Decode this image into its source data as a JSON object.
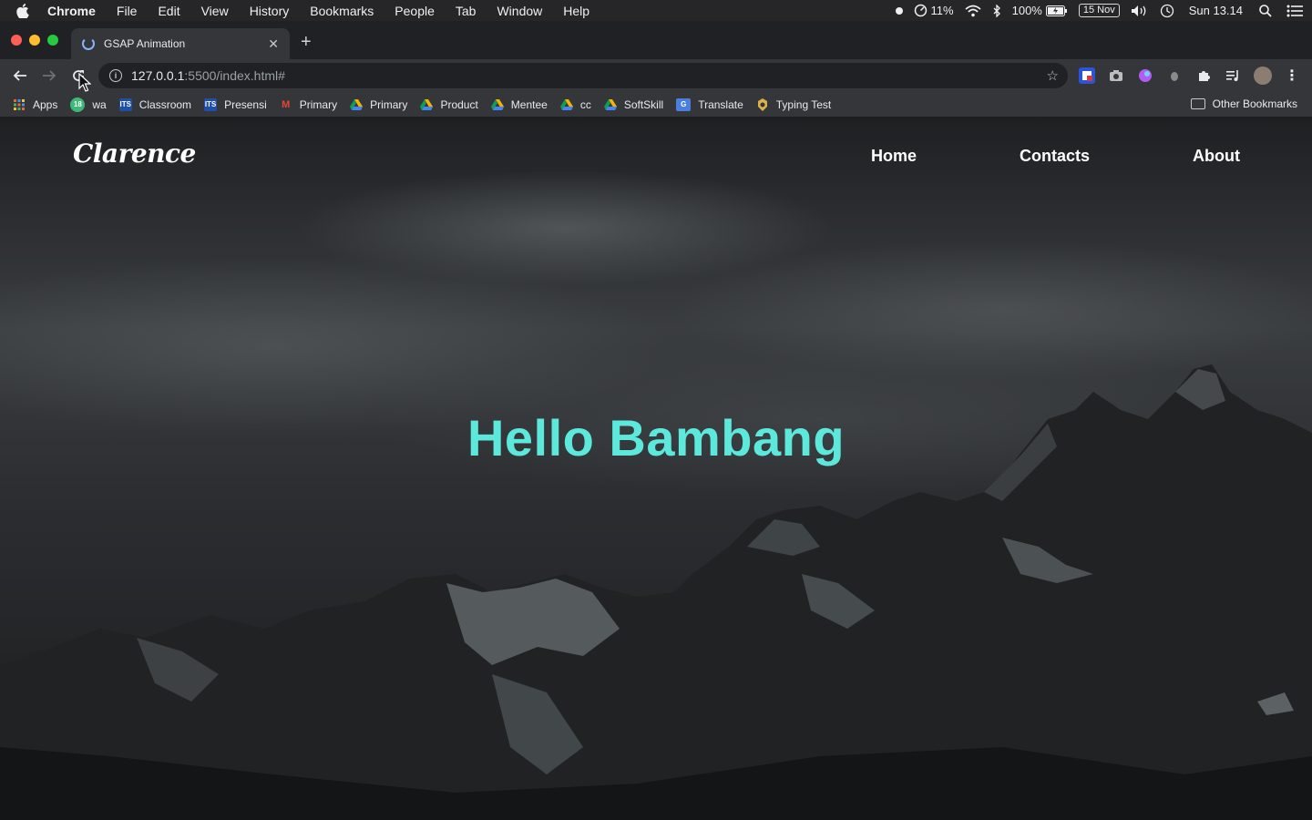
{
  "menubar": {
    "app_name": "Chrome",
    "items": [
      "File",
      "Edit",
      "View",
      "History",
      "Bookmarks",
      "People",
      "Tab",
      "Window",
      "Help"
    ],
    "status": {
      "cpu_percent": "11%",
      "battery_percent": "100%",
      "date_badge": "15 Nov",
      "clock": "Sun 13.14"
    }
  },
  "browser": {
    "tab_title": "GSAP Animation",
    "url_host": "127.0.0.1",
    "url_path": ":5500/index.html#",
    "bookmarks": [
      {
        "label": "Apps",
        "icon": "apps-grid-icon"
      },
      {
        "label": "wa",
        "icon": "whatsapp-icon",
        "badge": "18"
      },
      {
        "label": "Classroom",
        "icon": "its-icon",
        "badge": "ITS"
      },
      {
        "label": "Presensi",
        "icon": "its-icon",
        "badge": "ITS"
      },
      {
        "label": "Primary",
        "icon": "gmail-icon",
        "badge": "M"
      },
      {
        "label": "Primary",
        "icon": "drive-icon"
      },
      {
        "label": "Product",
        "icon": "drive-icon"
      },
      {
        "label": "Mentee",
        "icon": "drive-icon"
      },
      {
        "label": "cc",
        "icon": "drive-icon"
      },
      {
        "label": "SoftSkill",
        "icon": "drive-icon"
      },
      {
        "label": "Translate",
        "icon": "translate-icon",
        "badge": "G"
      },
      {
        "label": "Typing Test",
        "icon": "typing-test-icon"
      }
    ],
    "other_bookmarks": "Other Bookmarks"
  },
  "page": {
    "logo": "Clarence",
    "nav": {
      "home": "Home",
      "contacts": "Contacts",
      "about": "About"
    },
    "hero_title": "Hello Bambang"
  },
  "colors": {
    "accent": "#5ce9dc",
    "nav_text": "#ffffff"
  }
}
